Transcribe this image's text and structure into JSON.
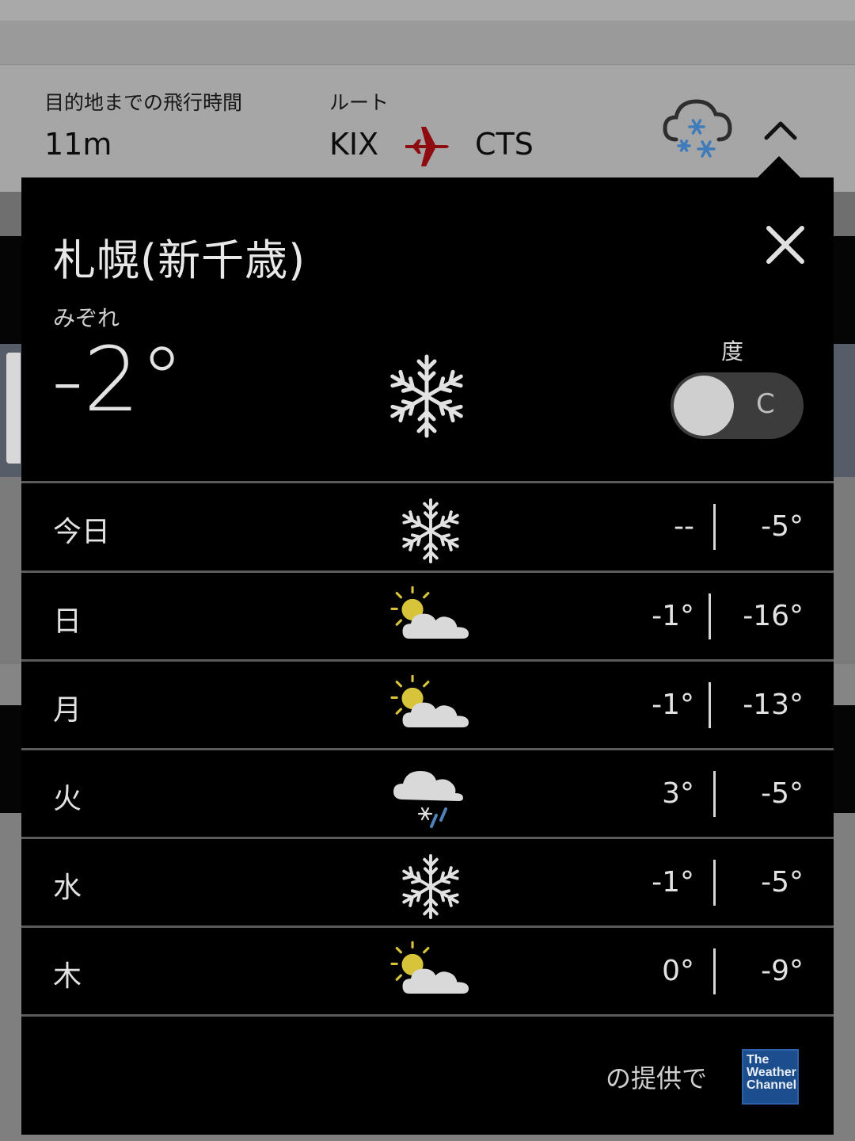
{
  "flight": {
    "time_label": "目的地までの飛行時間",
    "time_value": "11m",
    "route_label": "ルート",
    "origin": "KIX",
    "destination": "CTS",
    "weather_icon": "snow-cloud-icon",
    "expand_icon": "chevron-up-icon"
  },
  "weather": {
    "city": "札幌(新千歳)",
    "condition": "みぞれ",
    "current_temp": "-2°",
    "current_icon": "snowflake-icon",
    "unit_label": "度",
    "unit_toggle": "C",
    "forecast": [
      {
        "day": "今日",
        "icon": "snowflake-icon",
        "high": "--",
        "low": "-5°"
      },
      {
        "day": "日",
        "icon": "partly-cloudy-icon",
        "high": "-1°",
        "low": "-16°"
      },
      {
        "day": "月",
        "icon": "partly-cloudy-icon",
        "high": "-1°",
        "low": "-13°"
      },
      {
        "day": "火",
        "icon": "sleet-icon",
        "high": "3°",
        "low": "-5°"
      },
      {
        "day": "水",
        "icon": "snowflake-icon",
        "high": "-1°",
        "low": "-5°"
      },
      {
        "day": "木",
        "icon": "partly-cloudy-icon",
        "high": "0°",
        "low": "-9°"
      }
    ],
    "credit_text": "の提供で",
    "provider_logo": [
      "The",
      "Weather",
      "Channel"
    ]
  },
  "colors": {
    "panel_bg": "#000000",
    "plane_red": "#8e0b10",
    "snow_blue": "#4f83b8",
    "sun_yellow": "#d8c43a"
  }
}
